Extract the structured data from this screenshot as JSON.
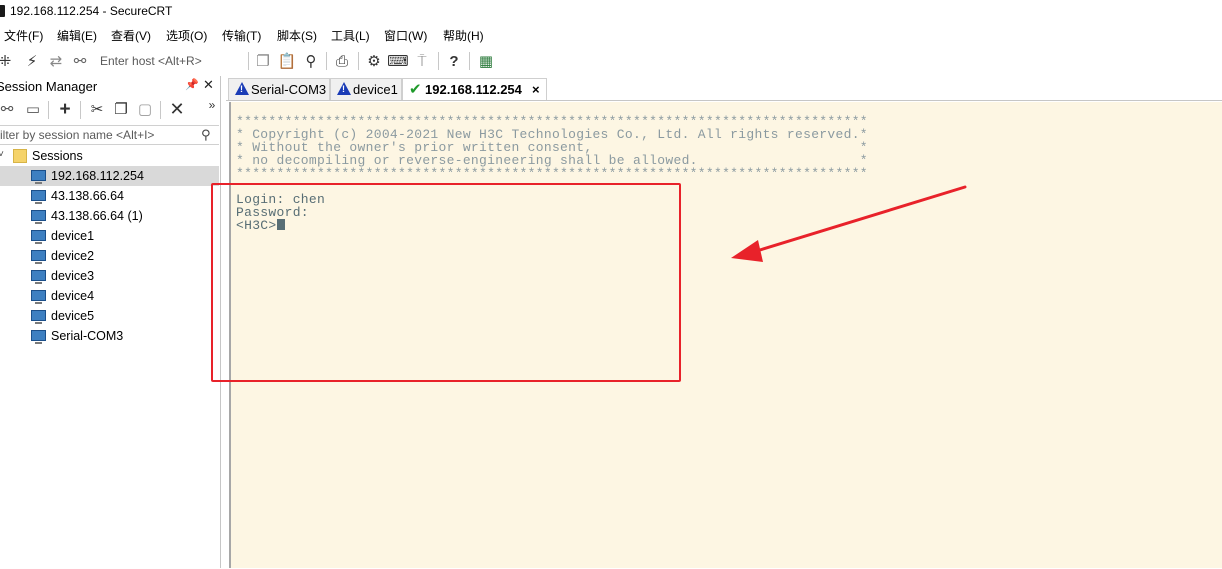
{
  "window": {
    "title": "192.168.112.254 - SecureCRT"
  },
  "menu": [
    "文件(F)",
    "编辑(E)",
    "查看(V)",
    "选项(O)",
    "传输(T)",
    "脚本(S)",
    "工具(L)",
    "窗口(W)",
    "帮助(H)"
  ],
  "toolbar": {
    "host_placeholder": "Enter host <Alt+R>"
  },
  "session_manager": {
    "title": "Session Manager",
    "filter_placeholder": "ilter by session name <Alt+I>",
    "root": "Sessions",
    "sessions": [
      "192.168.112.254",
      "43.138.66.64",
      "43.138.66.64 (1)",
      "device1",
      "device2",
      "device3",
      "device4",
      "device5",
      "Serial-COM3"
    ],
    "selected": "192.168.112.254"
  },
  "tabs": [
    {
      "label": "Serial-COM3",
      "status": "warning"
    },
    {
      "label": "device1",
      "status": "warning"
    },
    {
      "label": "192.168.112.254",
      "status": "connected",
      "active": true
    }
  ],
  "terminal": {
    "banner": [
      "******************************************************************************",
      "* Copyright (c) 2004-2021 New H3C Technologies Co., Ltd. All rights reserved.*",
      "* Without the owner's prior written consent,                                 *",
      "* no decompiling or reverse-engineering shall be allowed.                    *",
      "******************************************************************************"
    ],
    "session": [
      "Login: chen",
      "Password:",
      "<H3C>"
    ]
  },
  "colors": {
    "terminal_bg": "#fdf6e3",
    "terminal_fg": "#586e75",
    "annotation": "#e8222a",
    "connected": "#1f9a2b",
    "warning": "#1a3cb7"
  }
}
